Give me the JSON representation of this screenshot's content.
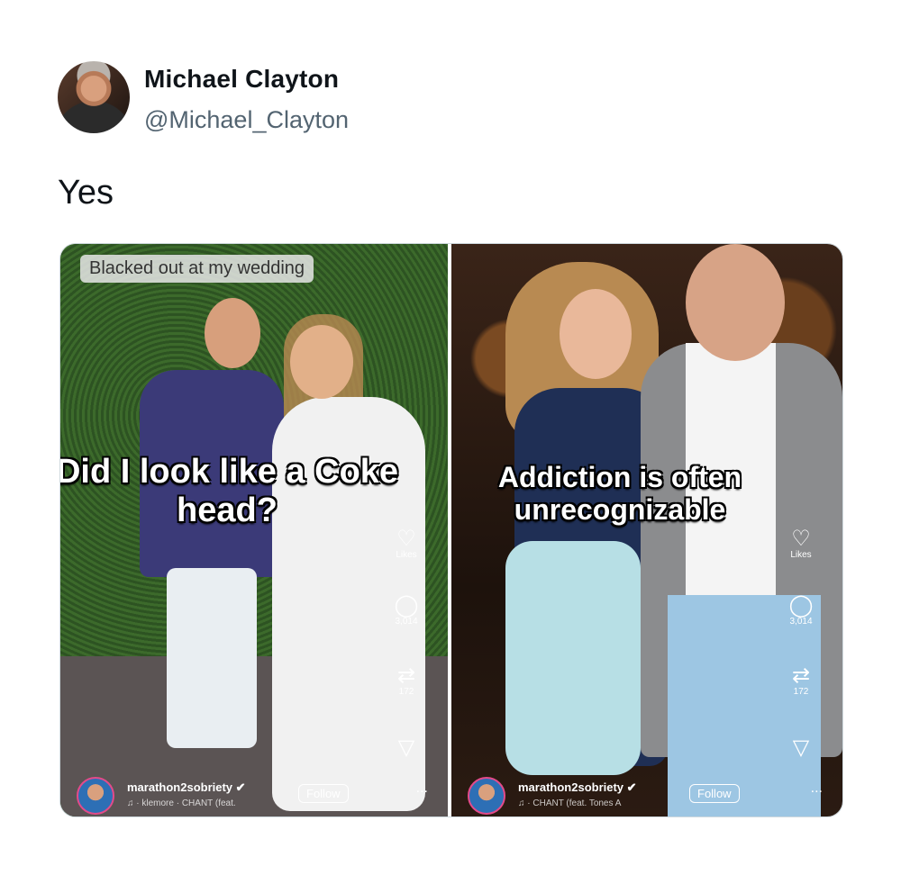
{
  "tweet": {
    "author_name": "Michael Clayton",
    "author_handle": "@Michael_Clayton",
    "text": "Yes"
  },
  "media": {
    "left": {
      "banner": "Blacked out at my wedding",
      "caption": "Did I look like a Coke head?",
      "likes_label": "Likes",
      "comments_count": "3,014",
      "reposts_count": "172",
      "username": "marathon2sobriety",
      "music": "♫ · klemore · CHANT (feat.",
      "follow_label": "Follow",
      "more": "..."
    },
    "right": {
      "caption": "Addiction is often unrecognizable",
      "likes_label": "Likes",
      "comments_count": "3,014",
      "reposts_count": "172",
      "username": "marathon2sobriety",
      "music": "♫ · CHANT (feat. Tones A",
      "follow_label": "Follow",
      "more": "..."
    }
  },
  "icons": [
    "heart-icon",
    "comment-icon",
    "repost-icon",
    "send-icon",
    "verified-icon",
    "music-icon"
  ]
}
